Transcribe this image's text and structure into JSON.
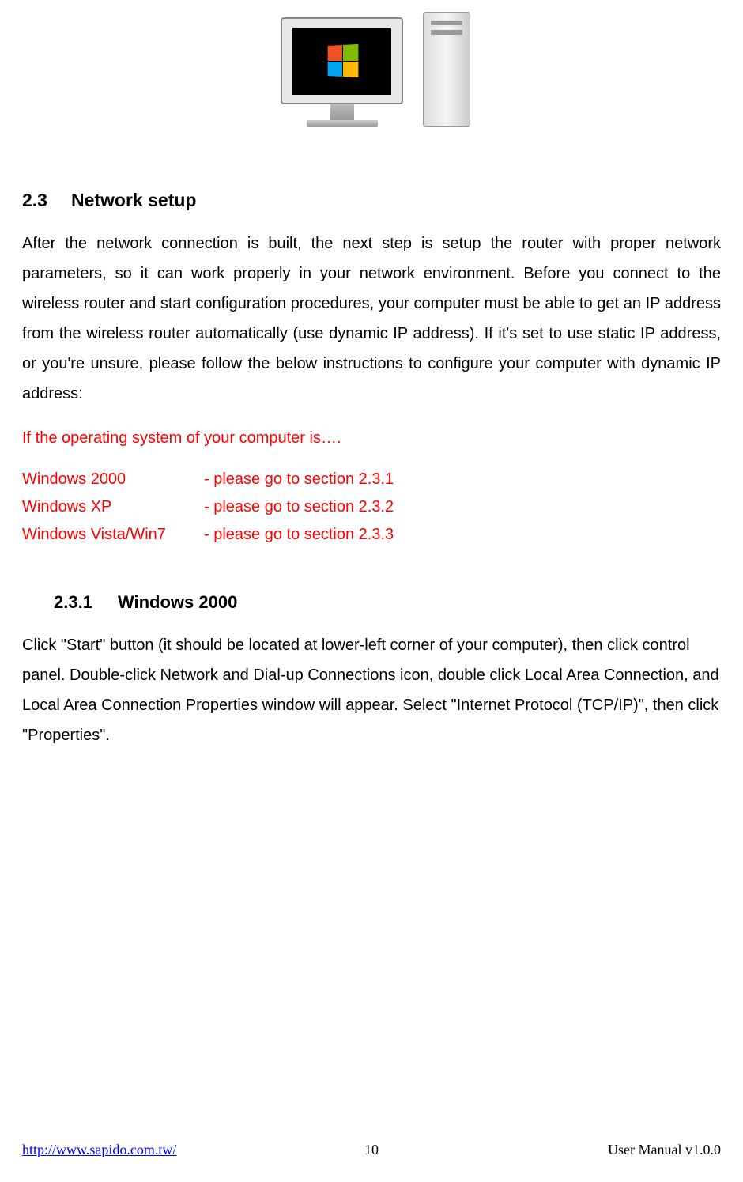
{
  "heading": {
    "number": "2.3",
    "title": "Network setup"
  },
  "paragraph1": "After the network connection is built, the next step is setup the router with proper network parameters, so it can work properly in your network environment.    Before you connect to the wireless router and start configuration procedures, your computer must be able to get an IP address from the wireless router automatically (use dynamic IP address). If it's set to use static IP address, or you're unsure, please follow the below instructions to configure your computer with dynamic IP address:",
  "red_intro": "If the operating system of your computer is….",
  "os_list": [
    {
      "name": "Windows 2000",
      "instruction": "- please go to section 2.3.1"
    },
    {
      "name": "Windows XP",
      "instruction": "- please go to section 2.3.2"
    },
    {
      "name": "Windows Vista/Win7",
      "instruction": "- please go to section 2.3.3"
    }
  ],
  "subheading": {
    "number": "2.3.1",
    "title": "Windows 2000"
  },
  "paragraph2": "Click \"Start\" button (it should be located at lower-left corner of your computer), then click control panel. Double-click Network and Dial-up Connections icon, double click Local Area Connection, and Local Area Connection Properties window will appear. Select \"Internet Protocol (TCP/IP)\", then click \"Properties\".",
  "footer": {
    "url": "http://www.sapido.com.tw/",
    "page": "10",
    "version": "User  Manual  v1.0.0"
  }
}
